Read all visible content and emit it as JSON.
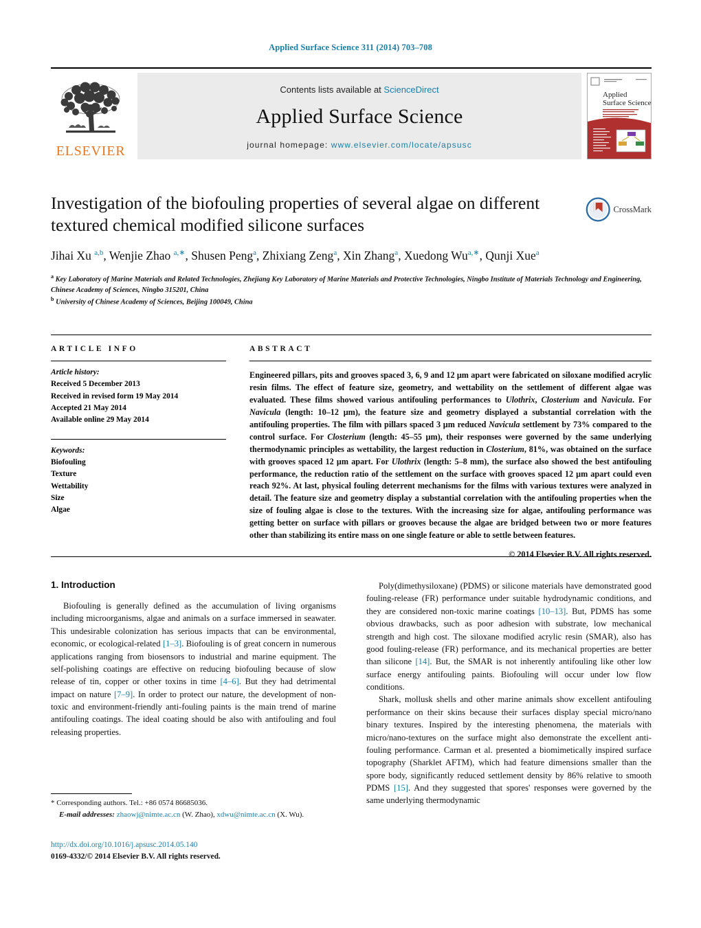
{
  "running_head": "Applied Surface Science 311 (2014) 703–708",
  "masthead": {
    "contents_prefix": "Contents lists available at ",
    "sciencedirect": "ScienceDirect",
    "journal_title": "Applied Surface Science",
    "homepage_label": "journal homepage: ",
    "homepage_url": "www.elsevier.com/locate/apsusc",
    "publisher_wordmark": "ELSEVIER",
    "publisher_logo_icon": "elsevier-tree-icon",
    "cover_title_line1": "Applied",
    "cover_title_line2": "Surface Science"
  },
  "article": {
    "title": "Investigation of the biofouling properties of several algae on different textured chemical modified silicone surfaces",
    "crossmark_label": "CrossMark",
    "crossmark_icon": "crossmark-icon",
    "authors_html": "Jihai Xu <sup>a,b</sup>, Wenjie Zhao <sup>a,∗</sup>, Shusen Peng<sup>a</sup>, Zhixiang Zeng<sup>a</sup>, Xin Zhang<sup>a</sup>, Xuedong Wu<sup>a,∗</sup>, Qunji Xue<sup>a</sup>",
    "affiliation_a": "Key Laboratory of Marine Materials and Related Technologies, Zhejiang Key Laboratory of Marine Materials and Protective Technologies, Ningbo Institute of Materials Technology and Engineering, Chinese Academy of Sciences, Ningbo 315201, China",
    "affiliation_b": "University of Chinese Academy of Sciences, Beijing 100049, China"
  },
  "article_info": {
    "heading": "ARTICLE INFO",
    "history_label": "Article history:",
    "history": [
      "Received 5 December 2013",
      "Received in revised form 19 May 2014",
      "Accepted 21 May 2014",
      "Available online 29 May 2014"
    ],
    "keywords_label": "Keywords:",
    "keywords": [
      "Biofouling",
      "Texture",
      "Wettability",
      "Size",
      "Algae"
    ]
  },
  "abstract": {
    "heading": "ABSTRACT",
    "body_html": "Engineered pillars, pits and grooves spaced 3, 6, 9 and 12 μm apart were fabricated on siloxane modified acrylic resin films. The effect of feature size, geometry, and wettability on the settlement of different algae was evaluated. These films showed various antifouling performances to <i>Ulothrix</i>, <i>Closterium</i> and <i>Navicula</i>. For <i>Navicula</i> (length: 10–12 μm), the feature size and geometry displayed a substantial correlation with the antifouling properties. The film with pillars spaced 3 μm reduced <i>Navicula</i> settlement by 73% compared to the control surface. For <i>Closterium</i> (length: 45–55 μm), their responses were governed by the same underlying thermodynamic principles as wettability, the largest reduction in <i>Closterium</i>, 81%, was obtained on the surface with grooves spaced 12 μm apart. For <i>Ulothrix</i> (length: 5–8 mm), the surface also showed the best antifouling performance, the reduction ratio of the settlement on the surface with grooves spaced 12 μm apart could even reach 92%. At last, physical fouling deterrent mechanisms for the films with various textures were analyzed in detail. The feature size and geometry display a substantial correlation with the antifouling properties when the size of fouling algae is close to the textures. With the increasing size for algae, antifouling performance was getting better on surface with pillars or grooves because the algae are bridged between two or more features other than stabilizing its entire mass on one single feature or able to settle between features.",
    "copyright": "© 2014 Elsevier B.V. All rights reserved."
  },
  "introduction": {
    "heading": "1.  Introduction",
    "left_paragraphs_html": [
      "Biofouling is generally defined as the accumulation of living organisms including microorganisms, algae and animals on a surface immersed in seawater. This undesirable colonization has serious impacts that can be environmental, economic, or ecological-related <span class=\"ref\">[1–3]</span>. Biofouling is of great concern in numerous applications ranging from biosensors to industrial and marine equipment. The self-polishing coatings are effective on reducing biofouling because of slow release of tin, copper or other toxins in time <span class=\"ref\">[4–6]</span>. But they had detrimental impact on nature <span class=\"ref\">[7–9]</span>. In order to protect our nature, the development of non-toxic and environment-friendly anti-fouling paints is the main trend of marine antifouling coatings. The ideal coating should be also with antifouling and foul releasing properties."
    ],
    "right_paragraphs_html": [
      "Poly(dimethysiloxane) (PDMS) or silicone materials have demonstrated good fouling-release (FR) performance under suitable hydrodynamic conditions, and they are considered non-toxic marine coatings <span class=\"ref\">[10–13]</span>. But, PDMS has some obvious drawbacks, such as poor adhesion with substrate, low mechanical strength and high cost. The siloxane modified acrylic resin (SMAR), also has good fouling-release (FR) performance, and its mechanical properties are better than silicone <span class=\"ref\">[14]</span>. But, the SMAR is not inherently antifouling like other low surface energy antifouling paints. Biofouling will occur under low flow conditions.",
      "Shark, mollusk shells and other marine animals show excellent antifouling performance on their skins because their surfaces display special micro/nano binary textures. Inspired by the interesting phenomena, the materials with micro/nano-textures on the surface might also demonstrate the excellent anti-fouling performance. Carman et al. presented a biomimetically inspired surface topography (Sharklet AFTM), which had feature dimensions smaller than the spore body, significantly reduced settlement density by 86% relative to smooth PDMS <span class=\"ref\">[15]</span>. And they suggested that spores' responses were governed by the same underlying thermodynamic"
    ]
  },
  "footnotes": {
    "corresponding_html": "<span class=\"star\">*</span>  Corresponding authors. Tel.: +86 0574 86685036.",
    "email_label": "E-mail addresses:",
    "email_1": "zhaowj@nimte.ac.cn",
    "email_1_owner": "(W. Zhao)",
    "email_2": "xdwu@nimte.ac.cn",
    "email_2_owner": "(X. Wu)."
  },
  "publication": {
    "doi": "http://dx.doi.org/10.1016/j.apsusc.2014.05.140",
    "issn_line": "0169-4332/© 2014 Elsevier B.V. All rights reserved."
  },
  "colors": {
    "link_blue": "#1a7fa8",
    "elsevier_orange": "#e87722",
    "masthead_grey": "#ebebeb",
    "cover_red": "#b03030"
  }
}
